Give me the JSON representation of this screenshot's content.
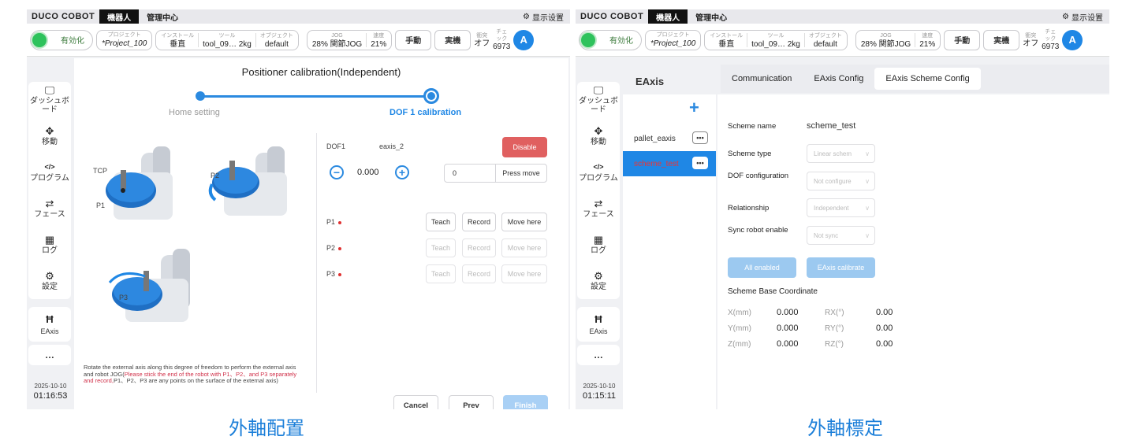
{
  "left": {
    "topbar": {
      "logo": "DUCO COBOT",
      "tab_robot": "機器人",
      "tab_mgmt": "管理中心",
      "display_settings": "显示设置"
    },
    "status": {
      "enable": "有効化",
      "project_label": "プロジェクト",
      "project_value": "*Project_100",
      "install_label": "インストール",
      "install_value": "垂直",
      "tool_label": "ツール",
      "tool_value": "tool_09… 2kg",
      "object_label": "オブジェクト",
      "object_value": "default",
      "jog_label": "JOG",
      "jog_value": "28%  関節JOG",
      "speed_label": "速度",
      "speed_value": "21%",
      "manual": "手動",
      "real": "実機",
      "collision_label": "衝突",
      "collision_value": "オフ",
      "check_label": "チェック",
      "check_value": "6973",
      "avatar": "A"
    },
    "sidebar": {
      "items": [
        {
          "label": "ダッシュボード"
        },
        {
          "label": "移動"
        },
        {
          "label": "プログラム"
        },
        {
          "label": "フェース"
        },
        {
          "label": "ログ"
        },
        {
          "label": "設定"
        }
      ],
      "eaxis": "EAxis",
      "more": "…",
      "date": "2025-10-10",
      "time": "01:16:53"
    },
    "main": {
      "title": "Positioner calibration(Independent)",
      "step1": "Home setting",
      "step2": "DOF 1 calibration",
      "img_labels": {
        "tcp": "TCP",
        "p1": "P1",
        "p2": "P2",
        "p3": "P3"
      },
      "dof_label": "DOF1",
      "dof_axis": "eaxis_2",
      "disable": "Disable",
      "value": "0.000",
      "input_value": "0",
      "press_move": "Press move",
      "points": [
        {
          "label": "P1",
          "teach": "Teach",
          "record": "Record",
          "move": "Move here"
        },
        {
          "label": "P2",
          "teach": "Teach",
          "record": "Record",
          "move": "Move here"
        },
        {
          "label": "P3",
          "teach": "Teach",
          "record": "Record",
          "move": "Move here"
        }
      ],
      "desc_start": "Rotate the external axis along this degree of freedom to perform the external axis and robot JOG(",
      "desc_red": "Please stick the end of the robot with P1、P2、and P3 separately and record,",
      "desc_end": "P1、P2、P3 are any points on the surface of the external axis)",
      "cancel": "Cancel",
      "prev": "Prev",
      "finish": "Finish"
    },
    "caption": "外軸配置"
  },
  "right": {
    "topbar": {
      "logo": "DUCO COBOT",
      "tab_robot": "機器人",
      "tab_mgmt": "管理中心",
      "display_settings": "显示设置"
    },
    "status": {
      "enable": "有効化",
      "project_label": "プロジェクト",
      "project_value": "*Project_100",
      "install_label": "インストール",
      "install_value": "垂直",
      "tool_label": "ツール",
      "tool_value": "tool_09… 2kg",
      "object_label": "オブジェクト",
      "object_value": "default",
      "jog_label": "JOG",
      "jog_value": "28%  関節JOG",
      "speed_label": "速度",
      "speed_value": "21%",
      "manual": "手動",
      "real": "実機",
      "collision_label": "衝突",
      "collision_value": "オフ",
      "check_label": "チェック",
      "check_value": "6973",
      "avatar": "A"
    },
    "sidebar": {
      "items": [
        {
          "label": "ダッシュボード"
        },
        {
          "label": "移動"
        },
        {
          "label": "プログラム"
        },
        {
          "label": "フェース"
        },
        {
          "label": "ログ"
        },
        {
          "label": "設定"
        }
      ],
      "eaxis": "EAxis",
      "more": "…",
      "date": "2025-10-10",
      "time": "01:15:11"
    },
    "header": "EAxis",
    "tabs": [
      "Communication",
      "EAxis Config",
      "EAxis Scheme Config"
    ],
    "schemes": [
      "pallet_eaxis",
      "scheme_test"
    ],
    "config": {
      "scheme_name_label": "Scheme name",
      "scheme_name_value": "scheme_test",
      "scheme_type_label": "Scheme type",
      "scheme_type_value": "Linear schem",
      "dof_label": "DOF configuration",
      "dof_value": "Not configure",
      "relationship_label": "Relationship",
      "relationship_value": "Independent",
      "sync_label": "Sync robot enable",
      "sync_value": "Not sync",
      "all_enabled": "All enabled",
      "eaxis_calibrate": "EAxis calibrate",
      "base_coord": "Scheme Base Coordinate",
      "coords": [
        {
          "label": "X(mm)",
          "value": "0.000"
        },
        {
          "label": "Y(mm)",
          "value": "0.000"
        },
        {
          "label": "Z(mm)",
          "value": "0.000"
        },
        {
          "label": "RX(°)",
          "value": "0.00"
        },
        {
          "label": "RY(°)",
          "value": "0.00"
        },
        {
          "label": "RZ(°)",
          "value": "0.00"
        }
      ]
    },
    "caption": "外軸標定"
  },
  "colors": {
    "accent": "#1f87e5",
    "enable_green": "#2ec25c",
    "disable_red": "#e06060",
    "caption_blue": "#1c7fd9"
  }
}
